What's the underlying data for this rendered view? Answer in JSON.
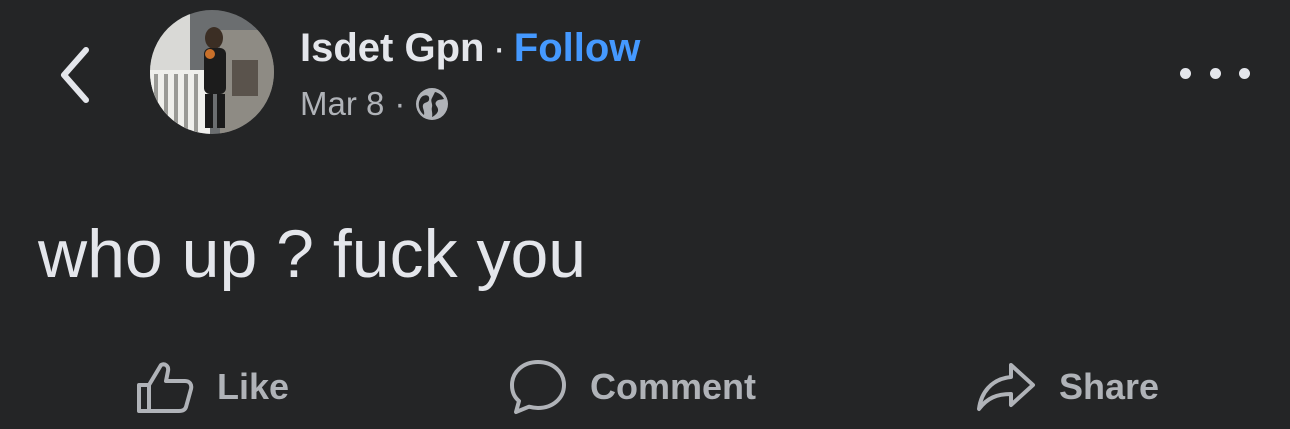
{
  "header": {
    "back_icon": "chevron-left-icon",
    "author_name": "Isdet Gpn",
    "separator": "·",
    "follow_label": "Follow",
    "date": "Mar 8",
    "meta_separator": "·",
    "audience_icon": "globe-icon",
    "more_icon": "more-horizontal-icon"
  },
  "post": {
    "text": "who up ? fuck you"
  },
  "actions": [
    {
      "label": "Like",
      "icon": "thumbs-up-icon"
    },
    {
      "label": "Comment",
      "icon": "comment-bubble-icon"
    },
    {
      "label": "Share",
      "icon": "share-arrow-icon"
    }
  ],
  "colors": {
    "background": "#242526",
    "primary_text": "#e4e6eb",
    "secondary_text": "#b0b3b8",
    "link": "#4599ff"
  }
}
